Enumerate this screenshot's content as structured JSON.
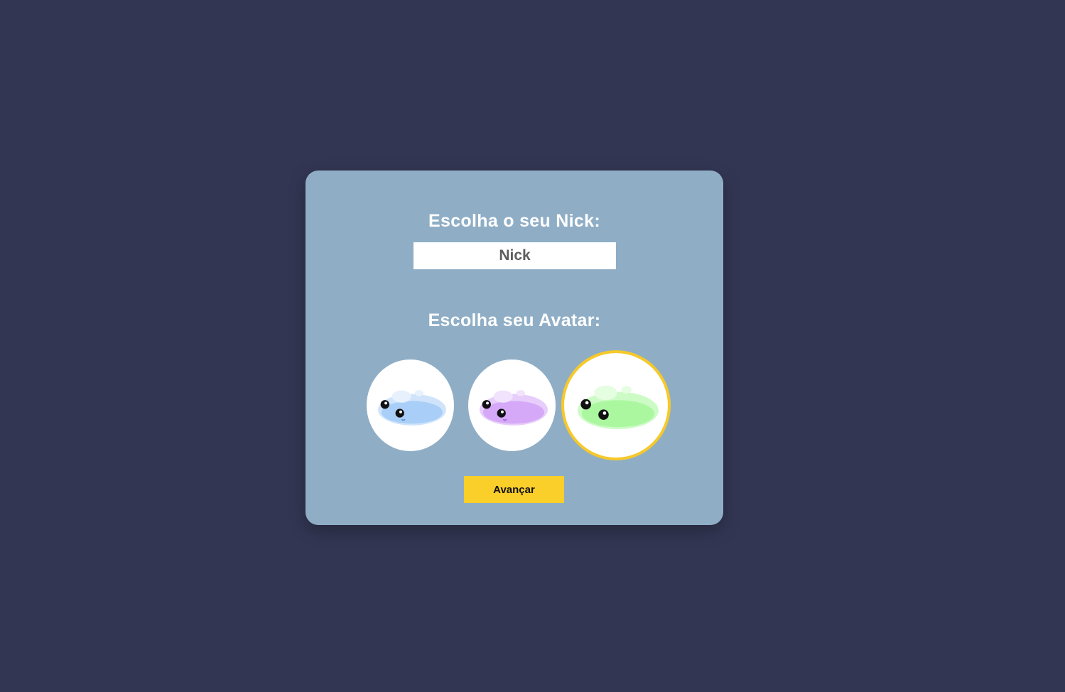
{
  "nick_section": {
    "title": "Escolha o seu Nick:",
    "input_value": "",
    "input_placeholder": "Nick"
  },
  "avatar_section": {
    "title": "Escolha seu Avatar:",
    "avatars": [
      {
        "icon": "blue-slime-icon",
        "color": "#a9cff8",
        "selected": false
      },
      {
        "icon": "purple-slime-icon",
        "color": "#d5a8f8",
        "selected": false
      },
      {
        "icon": "green-slime-icon",
        "color": "#abf7a0",
        "selected": true
      }
    ]
  },
  "next_button": {
    "label": "Avançar",
    "color": "#fbcf2a"
  },
  "colors": {
    "background": "#333653",
    "card": "#8faec6",
    "selected_border": "#f6c92a"
  }
}
